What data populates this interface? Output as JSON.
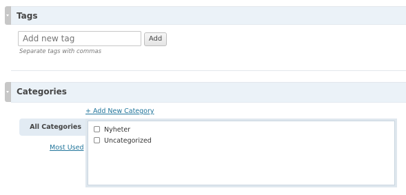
{
  "tags_box": {
    "title": "Tags",
    "input_placeholder": "Add new tag",
    "add_label": "Add",
    "hint": "Separate tags with commas"
  },
  "categories_box": {
    "title": "Categories",
    "add_new_link": "+ Add New Category",
    "tabs": [
      {
        "label": "All Categories",
        "active": true
      },
      {
        "label": "Most Used",
        "active": false
      }
    ],
    "items": [
      {
        "label": "Nyheter",
        "checked": false
      },
      {
        "label": "Uncategorized",
        "checked": false
      }
    ]
  },
  "colors": {
    "header_bg": "#ebf2f8",
    "link": "#21759b",
    "active_tab_bg": "#e2ebf3"
  }
}
